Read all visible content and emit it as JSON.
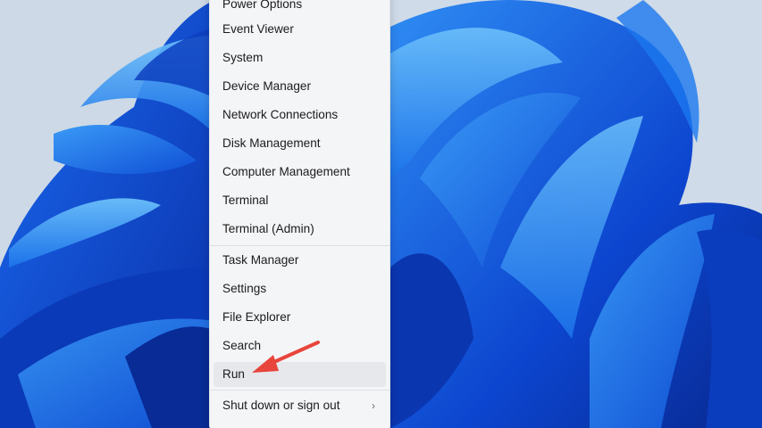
{
  "wallpaper": {
    "description_icon": "windows-11-bloom-wallpaper-icon",
    "colors": {
      "background": "#cfdbe8",
      "bloom_dark": "#0a3fc4",
      "bloom_mid": "#1466e8",
      "bloom_light": "#4aa6f5"
    }
  },
  "context_menu": {
    "items": [
      {
        "label": "Power Options"
      },
      {
        "label": "Event Viewer"
      },
      {
        "label": "System"
      },
      {
        "label": "Device Manager"
      },
      {
        "label": "Network Connections"
      },
      {
        "label": "Disk Management"
      },
      {
        "label": "Computer Management"
      },
      {
        "label": "Terminal"
      },
      {
        "label": "Terminal (Admin)"
      },
      {
        "label": "Task Manager"
      },
      {
        "label": "Settings"
      },
      {
        "label": "File Explorer"
      },
      {
        "label": "Search"
      },
      {
        "label": "Run"
      },
      {
        "label": "Shut down or sign out",
        "submenu": true
      }
    ],
    "highlighted_item": "Run",
    "submenu_icon": "chevron-right-icon"
  },
  "annotation": {
    "arrow_icon": "red-arrow-icon",
    "arrow_color": "#e8453c",
    "points_to": "Run"
  }
}
